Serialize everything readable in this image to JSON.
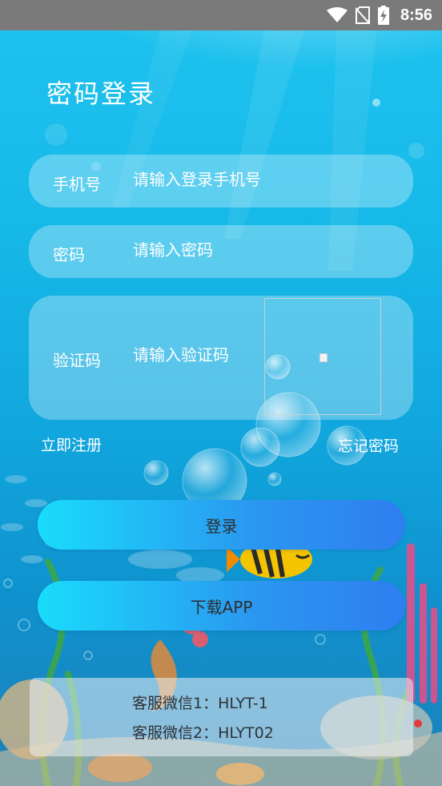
{
  "status_bar": {
    "time": "8:56",
    "icons": [
      "wifi-icon",
      "no-sim-icon",
      "battery-charging-icon"
    ]
  },
  "page": {
    "title": "密码登录"
  },
  "phone_field": {
    "label": "手机号",
    "placeholder": "请输入登录手机号"
  },
  "password_field": {
    "label": "密码",
    "placeholder": "请输入密码"
  },
  "captcha_field": {
    "label": "验证码",
    "placeholder": "请输入验证码"
  },
  "links": {
    "register": "立即注册",
    "forgot_password": "忘记密码"
  },
  "buttons": {
    "login": "登录",
    "download": "下载APP"
  },
  "customer_service": {
    "line1": "客服微信1：HLYT-1",
    "line2": "客服微信2：HLYT02"
  },
  "colors": {
    "background_top": "#1fc3ef",
    "background_bottom": "#1d7fb8",
    "button_gradient_start": "#19dcfb",
    "button_gradient_end": "#2f7ef0",
    "status_bar": "#7a7a7a"
  }
}
